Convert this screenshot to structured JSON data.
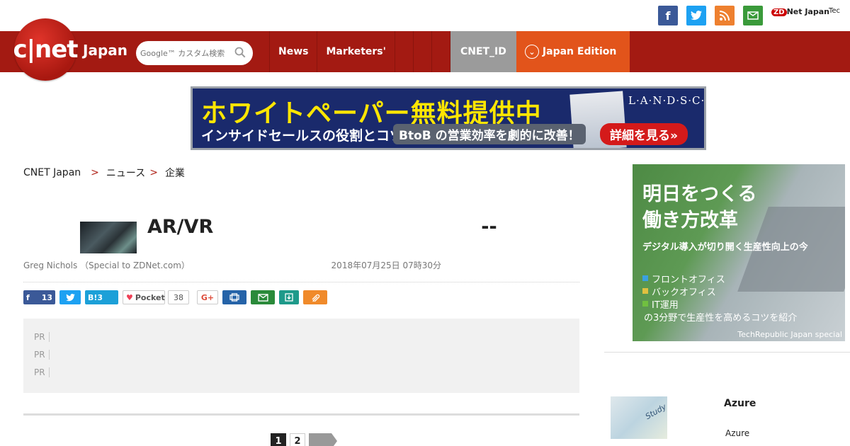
{
  "top_social": {
    "facebook": "f",
    "twitter": "t",
    "rss": "rss",
    "mail": "mail",
    "zdnet_logo": "ZDNet Japan",
    "zdnet_badge": "ZD",
    "zdnet_text": "Net Japan",
    "techrepublic_logo": "Tec"
  },
  "header": {
    "logo_text": "c|net",
    "logo_japan": "Japan",
    "search_placeholder": "Google™ カスタム検索",
    "nav": [
      "News",
      "Marketers'"
    ],
    "cnet_id": "CNET_ID",
    "edition": "Japan Edition"
  },
  "banner": {
    "headline": "ホワイトペーパー無料提供中",
    "sub": "インサイドセールスの役割とコツ",
    "pill": "BtoB の営業効率を劇的に改善！",
    "cta": "詳細を見る»",
    "brand": "L·A·N·D·S·C·A·P·E"
  },
  "breadcrumb": {
    "home": "CNET Japan",
    "level1": "ニュース",
    "level2": "企業"
  },
  "article": {
    "title": "　　　　　　AR/VR　　　　　　　　　　　　　　--　　　　　　　　　　",
    "title_line1": "　　　　　　AR/VR　　　　　　　　　　　　　　--　　　　　　",
    "title_line2": "　　　　",
    "byline": "Greg Nichols （Special to ZDNet.com） 　　　　　 　　　　　　　　　　　2018年07月25日 07時30分"
  },
  "share": {
    "facebook_count": "13",
    "hatena_count": "3",
    "hatena_label": "B!",
    "pocket_label": "Pocket",
    "pocket_count": "38",
    "gplus_label": "G+"
  },
  "pr": {
    "tag": "PR",
    "items": [
      "　　　　　　　　　　　　　　　　　　　　　　　　　　　　　　　　　　　　　　　　",
      "　　　　　　　　　　　　　　　　　　　　　　　　　　　　　　　　　　　　　　　　　　　　　　　",
      "　　　　　　　　　　　　　　　　　　　　　　　　　　　　　　　　　　　　　　　　　　　　　　"
    ]
  },
  "pager": {
    "page1": "1",
    "page2": "2"
  },
  "sidead": {
    "big_line1": "明日をつくる",
    "big_line2": "働き方改革",
    "sub": "デジタル導入が切り開く生産性向上の今",
    "items": [
      "フロントオフィス",
      "バックオフィス",
      "IT運用"
    ],
    "item_colors": [
      "#3aa0e0",
      "#e0c040",
      "#70c040"
    ],
    "last": "の3分野で生産性を高めるコツを紹介",
    "credit": "TechRepublic Japan special"
  },
  "related": {
    "section_title": "　　　　",
    "thumb_text": "Study",
    "headline": "　　　　　Azure　　　　",
    "desc_line1": "　　　　　　　　　　　　　　　　　　　　",
    "desc_line2": "　　　　　　Azure　　　　　　　　　　"
  }
}
